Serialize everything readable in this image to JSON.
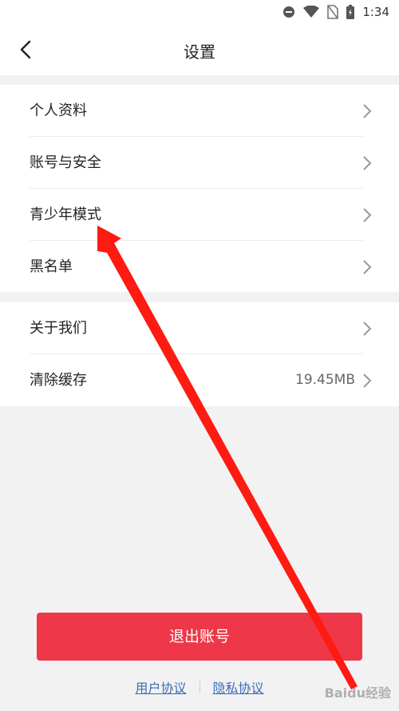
{
  "status_bar": {
    "time": "1:34",
    "icons": [
      "do-not-disturb-icon",
      "wifi-icon",
      "no-sim-icon",
      "battery-icon"
    ]
  },
  "header": {
    "title": "设置",
    "back_icon": "chevron-left-icon"
  },
  "settings_group_1": [
    {
      "label": "个人资料"
    },
    {
      "label": "账号与安全"
    },
    {
      "label": "青少年模式"
    },
    {
      "label": "黑名单"
    }
  ],
  "settings_group_2": [
    {
      "label": "关于我们",
      "value": ""
    },
    {
      "label": "清除缓存",
      "value": "19.45MB"
    }
  ],
  "logout_label": "退出账号",
  "footer": {
    "user_agreement": "用户协议",
    "privacy_policy": "隐私协议"
  },
  "watermark": "Baidu经验",
  "colors": {
    "accent": "#ee3748",
    "link": "#3d6ab5",
    "annotation_arrow": "#ff1a12",
    "background": "#f2f2f2"
  }
}
